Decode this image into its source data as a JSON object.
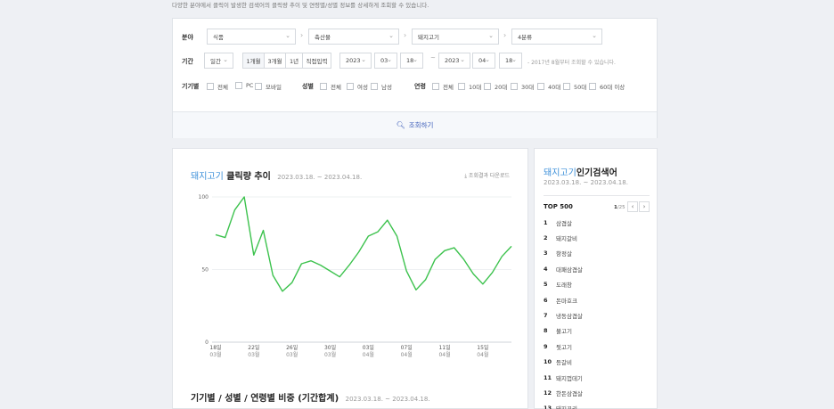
{
  "description": "다양한 분야에서 클릭이 발생한 검색어의 클릭량 추이 및 연령별/성별 정보를 상세하게 조회할 수 있습니다.",
  "filters": {
    "field_label": "분야",
    "field_selects": [
      "식품",
      "축산물",
      "돼지고기",
      "4분류"
    ],
    "period_label": "기간",
    "period_unit": "일간",
    "period_buttons": [
      "1개월",
      "3개월",
      "1년",
      "직접입력"
    ],
    "start": {
      "year": "2023",
      "month": "03",
      "day": "18"
    },
    "end": {
      "year": "2023",
      "month": "04",
      "day": "18"
    },
    "period_hint": "2017년 8월부터 조회할 수 있습니다.",
    "device_label": "기기별",
    "device_options": [
      "전체",
      "PC",
      "모바일"
    ],
    "gender_label": "성별",
    "gender_options": [
      "전체",
      "여성",
      "남성"
    ],
    "age_label": "연령",
    "age_options": [
      "전체",
      "10대",
      "20대",
      "30대",
      "40대",
      "50대",
      "60대 이상"
    ],
    "search_label": "조회하기"
  },
  "chart_card": {
    "keyword": "돼지고기",
    "title_suffix": "클릭량 추이",
    "dates": "2023.03.18. ~ 2023.04.18.",
    "download_label": "조회결과 다운로드",
    "section2_title": "기기별 / 성별 / 연령별 비중 (기간합계)",
    "section2_dates": "2023.03.18. ~ 2023.04.18."
  },
  "chart_data": {
    "type": "line",
    "x": [
      "18",
      "19",
      "20",
      "21",
      "22",
      "23",
      "24",
      "25",
      "26",
      "27",
      "28",
      "29",
      "30",
      "31",
      "01",
      "02",
      "03",
      "04",
      "05",
      "06",
      "07",
      "08",
      "09",
      "10",
      "11",
      "12",
      "13",
      "14",
      "15",
      "16",
      "17",
      "18"
    ],
    "tick_labels": [
      {
        "day": "18일",
        "month": "03월"
      },
      {
        "day": "22일",
        "month": "03월"
      },
      {
        "day": "26일",
        "month": "03월"
      },
      {
        "day": "30일",
        "month": "03월"
      },
      {
        "day": "03일",
        "month": "04월"
      },
      {
        "day": "07일",
        "month": "04월"
      },
      {
        "day": "11일",
        "month": "04월"
      },
      {
        "day": "15일",
        "month": "04월"
      }
    ],
    "series": [
      {
        "values": [
          74,
          72,
          91,
          100,
          60,
          77,
          46,
          35,
          41,
          54,
          56,
          53,
          49,
          45,
          53,
          62,
          73,
          76,
          84,
          73,
          49,
          36,
          43,
          57,
          63,
          65,
          57,
          47,
          40,
          48,
          59,
          66
        ]
      }
    ],
    "yticks": [
      0,
      50,
      100
    ],
    "ylim": [
      0,
      100
    ],
    "color": "#3cc24d"
  },
  "rank_card": {
    "keyword": "돼지고기",
    "title_suffix": "인기검색어",
    "dates": "2023.03.18. ~ 2023.04.18.",
    "top_label": "TOP 500",
    "page_current": "1",
    "page_total": "/25",
    "items": [
      {
        "rank": "1",
        "term": "삼겹살"
      },
      {
        "rank": "2",
        "term": "돼지갈비"
      },
      {
        "rank": "3",
        "term": "항정살"
      },
      {
        "rank": "4",
        "term": "대패삼겹살"
      },
      {
        "rank": "5",
        "term": "도래창"
      },
      {
        "rank": "6",
        "term": "돈마호크"
      },
      {
        "rank": "7",
        "term": "냉동삼겹살"
      },
      {
        "rank": "8",
        "term": "불고기"
      },
      {
        "rank": "9",
        "term": "뒷고기"
      },
      {
        "rank": "10",
        "term": "등갈비"
      },
      {
        "rank": "11",
        "term": "돼지껍데기"
      },
      {
        "rank": "12",
        "term": "한돈삼겹살"
      },
      {
        "rank": "13",
        "term": "돼지꼬리"
      }
    ]
  }
}
